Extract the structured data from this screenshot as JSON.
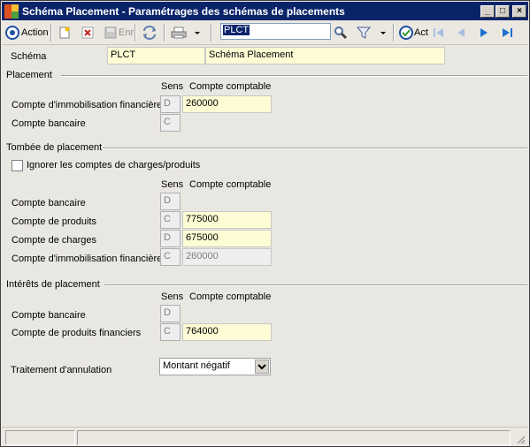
{
  "window": {
    "title": "Schéma Placement -  Paramétrages des schémas de placements",
    "min_glyph": "_",
    "max_glyph": "□",
    "close_glyph": "×"
  },
  "toolbar": {
    "action_label": "Action",
    "save_label": "Enr",
    "search_value": "PLCT",
    "act_label": "Act"
  },
  "schema": {
    "label": "Schéma",
    "code": "PLCT",
    "name": "Schéma Placement"
  },
  "placement": {
    "title": "Placement",
    "sens_header": "Sens",
    "compte_header": "Compte comptable",
    "rows": [
      {
        "label": "Compte d'immobilisation financière",
        "sens": "D",
        "compte": "260000"
      },
      {
        "label": "Compte bancaire",
        "sens": "C",
        "compte": ""
      }
    ]
  },
  "tombee": {
    "title": "Tombée de placement",
    "ignore_label": "Ignorer les comptes de charges/produits",
    "sens_header": "Sens",
    "compte_header": "Compte comptable",
    "rows": [
      {
        "label": "Compte bancaire",
        "sens": "D",
        "compte": ""
      },
      {
        "label": "Compte de produits",
        "sens": "C",
        "compte": "775000"
      },
      {
        "label": "Compte de charges",
        "sens": "D",
        "compte": "675000"
      },
      {
        "label": "Compte d'immobilisation financière",
        "sens": "C",
        "compte": "260000"
      }
    ]
  },
  "interets": {
    "title": "Intérêts de placement",
    "sens_header": "Sens",
    "compte_header": "Compte comptable",
    "rows": [
      {
        "label": "Compte bancaire",
        "sens": "D",
        "compte": ""
      },
      {
        "label": "Compte de produits financiers",
        "sens": "C",
        "compte": "764000"
      }
    ]
  },
  "annulation": {
    "label": "Traitement d'annulation",
    "selected": "Montant négatif"
  },
  "colors": {
    "title_bar": "#0a246a",
    "field_bg": "#fdfcd4"
  }
}
